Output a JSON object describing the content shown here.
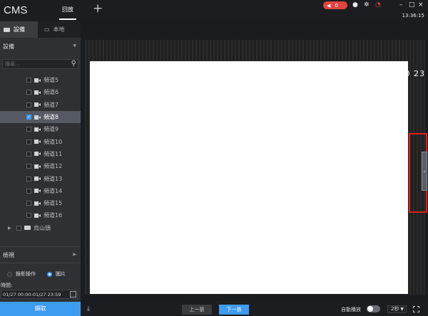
{
  "app": {
    "brand": "CMS",
    "time": "13:36:15"
  },
  "tabs": {
    "main": "回放",
    "add": "+"
  },
  "topbar": {
    "alarm_count": "0",
    "alarm_color": "#e0443e"
  },
  "panel": {
    "tab_devices": "設備",
    "tab_local": "本地",
    "device_header": "設備",
    "search_placeholder": "搜尋...",
    "channels": [
      {
        "label": "頻道5",
        "checked": false
      },
      {
        "label": "頻道6",
        "checked": false
      },
      {
        "label": "頻道7",
        "checked": false
      },
      {
        "label": "頻道8",
        "checked": true
      },
      {
        "label": "頻道9",
        "checked": false
      },
      {
        "label": "頻道10",
        "checked": false
      },
      {
        "label": "頻道11",
        "checked": false
      },
      {
        "label": "頻道12",
        "checked": false
      },
      {
        "label": "頻道13",
        "checked": false
      },
      {
        "label": "頻道14",
        "checked": false
      },
      {
        "label": "頻道15",
        "checked": false
      },
      {
        "label": "頻道16",
        "checked": false
      }
    ],
    "group_label": "烏山頭",
    "view_header": "檢視",
    "radio_record": "錄影操作",
    "radio_picture": "圖片",
    "time_label": "時間:",
    "time_range": "01/27 00:00-01/27 23:59"
  },
  "viewer": {
    "osd_timestamp": "0 23"
  },
  "bottom": {
    "capture": "擷取",
    "prev": "上一張",
    "next": "下一張",
    "autoplay": "自動播放",
    "interval": "2秒"
  },
  "colors": {
    "accent": "#3d9bf0",
    "highlight": "#e01d1d"
  }
}
